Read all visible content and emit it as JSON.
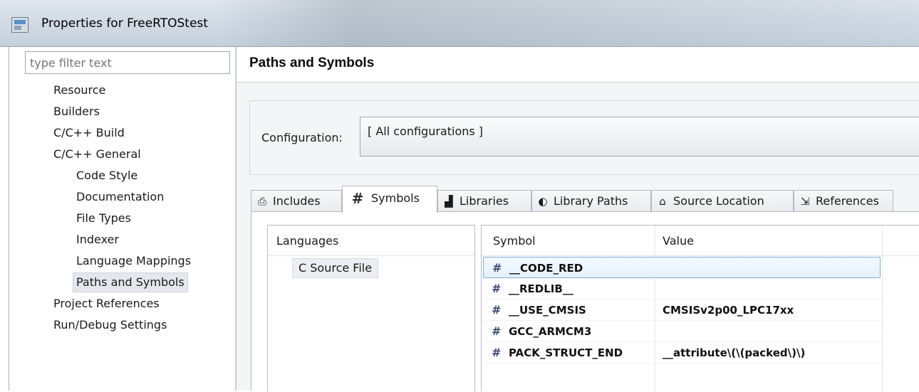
{
  "window": {
    "title": "Properties for FreeRTOStest"
  },
  "sidebar": {
    "filter_placeholder": "type filter text",
    "items": [
      {
        "label": "Resource",
        "indent": 0
      },
      {
        "label": "Builders",
        "indent": 0
      },
      {
        "label": "C/C++ Build",
        "indent": 0
      },
      {
        "label": "C/C++ General",
        "indent": 0
      },
      {
        "label": "Code Style",
        "indent": 1
      },
      {
        "label": "Documentation",
        "indent": 1
      },
      {
        "label": "File Types",
        "indent": 1
      },
      {
        "label": "Indexer",
        "indent": 1
      },
      {
        "label": "Language Mappings",
        "indent": 1
      },
      {
        "label": "Paths and Symbols",
        "indent": 1,
        "selected": true
      },
      {
        "label": "Project References",
        "indent": 0
      },
      {
        "label": "Run/Debug Settings",
        "indent": 0
      }
    ]
  },
  "page": {
    "title": "Paths and Symbols"
  },
  "configuration": {
    "label": "Configuration:",
    "value": "[ All configurations ]"
  },
  "tabs": [
    {
      "label": "Includes",
      "icon": "includes-icon",
      "glyph": "⎙"
    },
    {
      "label": "Symbols",
      "icon": "hash-icon",
      "glyph": "#",
      "active": true
    },
    {
      "label": "Libraries",
      "icon": "libraries-icon",
      "glyph": "▟"
    },
    {
      "label": "Library Paths",
      "icon": "library-paths-icon",
      "glyph": "◐"
    },
    {
      "label": "Source Location",
      "icon": "folder-icon",
      "glyph": "⌂"
    },
    {
      "label": "References",
      "icon": "references-icon",
      "glyph": "⇲"
    }
  ],
  "languages": {
    "header": "Languages",
    "items": [
      "C Source File"
    ]
  },
  "symbols": {
    "columns": {
      "symbol": "Symbol",
      "value": "Value"
    },
    "rows": [
      {
        "symbol": "__CODE_RED",
        "value": "",
        "selected": true
      },
      {
        "symbol": "__REDLIB__",
        "value": ""
      },
      {
        "symbol": "__USE_CMSIS",
        "value": "CMSISv2p00_LPC17xx"
      },
      {
        "symbol": "GCC_ARMCM3",
        "value": ""
      },
      {
        "symbol": "PACK_STRUCT_END",
        "value": "__attribute\\(\\(packed\\)\\)"
      }
    ]
  },
  "colors": {
    "titlebar": "#cfd8e3",
    "selection_border": "#84acd7",
    "panel_bg": "#f4f5f6"
  }
}
